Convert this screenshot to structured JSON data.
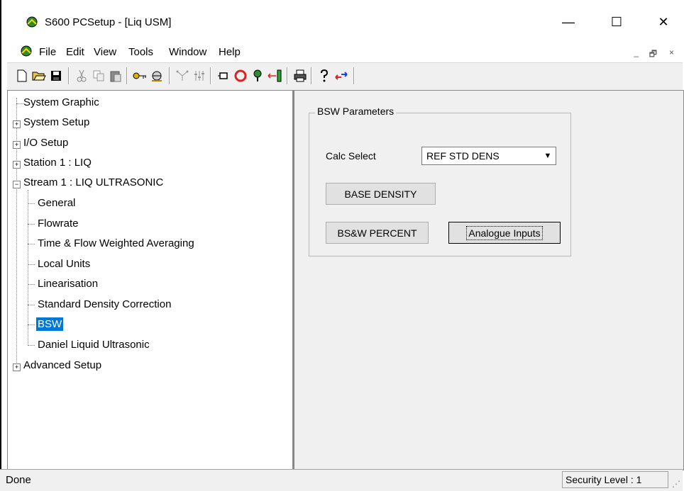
{
  "window": {
    "title": "S600 PCSetup  - [Liq USM]",
    "controls": {
      "minimize": "—",
      "maximize": "☐",
      "close": "✕"
    }
  },
  "menu": {
    "items": [
      "File",
      "Edit",
      "View",
      "Tools",
      "Window",
      "Help"
    ],
    "mdi_controls": {
      "minimize": "_",
      "restore": "🗗",
      "close": "×"
    }
  },
  "toolbar": {
    "icons": [
      "new-icon",
      "open-icon",
      "save-icon",
      "cut-icon",
      "copy-icon",
      "paste-icon",
      "key-icon",
      "connect-icon",
      "hierarchy-icon",
      "sliders-icon",
      "minimize-box-icon",
      "stop-icon",
      "pin-icon",
      "transfer-icon",
      "print-icon",
      "help-icon",
      "swap-icon"
    ]
  },
  "tree": {
    "items": [
      {
        "label": "System Graphic"
      },
      {
        "label": "System Setup",
        "expander": "+"
      },
      {
        "label": "I/O Setup",
        "expander": "+"
      },
      {
        "label": "Station 1 : LIQ",
        "expander": "+"
      },
      {
        "label": "Stream 1 : LIQ ULTRASONIC",
        "expander": "−"
      },
      {
        "label": "General"
      },
      {
        "label": "Flowrate"
      },
      {
        "label": "Time & Flow Weighted Averaging"
      },
      {
        "label": "Local Units"
      },
      {
        "label": "Linearisation"
      },
      {
        "label": "Standard Density Correction"
      },
      {
        "label": "BSW",
        "selected": true
      },
      {
        "label": "Daniel Liquid Ultrasonic"
      },
      {
        "label": "Advanced Setup",
        "expander": "+"
      }
    ]
  },
  "panel": {
    "group_title": "BSW Parameters",
    "calc_select_label": "Calc Select",
    "calc_select_value": "REF STD DENS",
    "base_density_button": "BASE DENSITY",
    "bsw_percent_button": "BS&W PERCENT",
    "analogue_inputs_button": "Analogue Inputs"
  },
  "status": {
    "left": "Done",
    "security": "Security Level : 1"
  },
  "colors": {
    "selection": "#0078d7",
    "face": "#f0f0f0"
  }
}
